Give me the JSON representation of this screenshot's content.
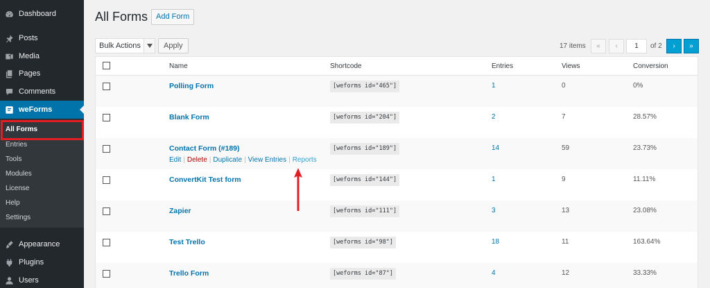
{
  "sidebar": {
    "items": [
      {
        "label": "Dashboard",
        "icon": "dashboard-icon"
      },
      {
        "label": "Posts",
        "icon": "pin-icon"
      },
      {
        "label": "Media",
        "icon": "media-icon"
      },
      {
        "label": "Pages",
        "icon": "pages-icon"
      },
      {
        "label": "Comments",
        "icon": "comments-icon"
      },
      {
        "label": "weForms",
        "icon": "weforms-icon"
      },
      {
        "label": "Appearance",
        "icon": "brush-icon"
      },
      {
        "label": "Plugins",
        "icon": "plug-icon"
      },
      {
        "label": "Users",
        "icon": "users-icon"
      }
    ],
    "submenu": [
      "All Forms",
      "Entries",
      "Tools",
      "Modules",
      "License",
      "Help",
      "Settings"
    ],
    "active_color": "#0073aa"
  },
  "header": {
    "title": "All Forms",
    "add_button": "Add Form"
  },
  "toolbar": {
    "bulk_actions": "Bulk Actions",
    "apply": "Apply"
  },
  "pagination": {
    "items": "17 items",
    "first": "«",
    "prev": "‹",
    "current_page": "1",
    "of_pages": "of 2",
    "next": "›",
    "last": "»"
  },
  "table": {
    "columns": [
      "Name",
      "Shortcode",
      "Entries",
      "Views",
      "Conversion"
    ],
    "rows": [
      {
        "name": "Polling Form",
        "shortcode": "[weforms id=\"465\"]",
        "entries": "1",
        "views": "0",
        "conversion": "0%"
      },
      {
        "name": "Blank Form",
        "shortcode": "[weforms id=\"204\"]",
        "entries": "2",
        "views": "7",
        "conversion": "28.57%"
      },
      {
        "name": "Contact Form (#189)",
        "shortcode": "[weforms id=\"189\"]",
        "entries": "14",
        "views": "59",
        "conversion": "23.73%"
      },
      {
        "name": "ConvertKit Test form",
        "shortcode": "[weforms id=\"144\"]",
        "entries": "1",
        "views": "9",
        "conversion": "11.11%"
      },
      {
        "name": "Zapier",
        "shortcode": "[weforms id=\"111\"]",
        "entries": "3",
        "views": "13",
        "conversion": "23.08%"
      },
      {
        "name": "Test Trello",
        "shortcode": "[weforms id=\"98\"]",
        "entries": "18",
        "views": "11",
        "conversion": "163.64%"
      },
      {
        "name": "Trello Form",
        "shortcode": "[weforms id=\"87\"]",
        "entries": "4",
        "views": "12",
        "conversion": "33.33%"
      }
    ],
    "row_actions": {
      "edit": "Edit",
      "delete": "Delete",
      "duplicate": "Duplicate",
      "view_entries": "View Entries",
      "reports": "Reports",
      "separator": "|"
    }
  },
  "annotation_color": "#e21d24"
}
